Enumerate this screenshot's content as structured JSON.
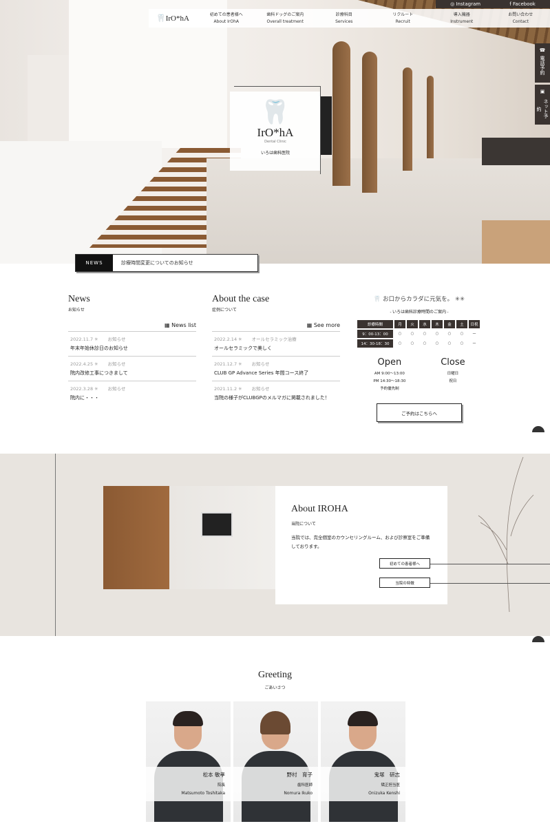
{
  "topbar": {
    "instagram": "Instagram",
    "facebook": "Facebook"
  },
  "nav": {
    "logo": "IrO*hA",
    "items": [
      {
        "jp": "初めての患者様へ",
        "en": "About IrOhA"
      },
      {
        "jp": "歯科ドッグのご案内",
        "en": "Overall treatment"
      },
      {
        "jp": "診療科目",
        "en": "Services"
      },
      {
        "jp": "リクルート",
        "en": "Recruit"
      },
      {
        "jp": "導入機器",
        "en": "Instrument"
      },
      {
        "jp": "お問い合わせ",
        "en": "Contact"
      }
    ]
  },
  "side": {
    "phone": "電話予約",
    "net": "ネット予約"
  },
  "hero": {
    "logo": "IrO*hA",
    "logo_sub": "Dental Clinic",
    "clinic": "いろは歯科医院"
  },
  "newsbar": {
    "label": "NEWS",
    "text": "診療時間変更についてのお知らせ"
  },
  "news": {
    "title": "News",
    "sub": "お知らせ",
    "more": "News list",
    "items": [
      {
        "date": "2022.11.7",
        "cat": "お知らせ",
        "title": "年末年始休診日のお知らせ"
      },
      {
        "date": "2022.4.25",
        "cat": "お知らせ",
        "title": "院内改修工事につきまして"
      },
      {
        "date": "2022.3.28",
        "cat": "お知らせ",
        "title": "院内に・・・"
      }
    ]
  },
  "cases": {
    "title": "About the case",
    "sub": "症例について",
    "more": "See more",
    "items": [
      {
        "date": "2022.2.14",
        "cat": "オールセラミック治療",
        "title": "オールセラミックで美しく"
      },
      {
        "date": "2021.12.7",
        "cat": "お知らせ",
        "title": "CLUB GP Advance Series 年間コース終了"
      },
      {
        "date": "2021.11.2",
        "cat": "お知らせ",
        "title": "当院の様子がCLUBGPのメルマガに掲載されました！"
      }
    ]
  },
  "hours": {
    "tagline": "お口からカラダに元気を。",
    "guide": "- いろは歯科診療時間のご案内 -",
    "header": [
      "診療時間",
      "月",
      "火",
      "水",
      "木",
      "金",
      "土",
      "日祝"
    ],
    "rows": [
      {
        "time": "9：00-13：00",
        "marks": [
          "○",
          "○",
          "○",
          "○",
          "○",
          "○",
          "ー"
        ]
      },
      {
        "time": "14：30-18：30",
        "marks": [
          "○",
          "○",
          "○",
          "○",
          "○",
          "○",
          "ー"
        ]
      }
    ],
    "open": {
      "title": "Open",
      "am": "AM  9:00〜13:00",
      "pm": "PM 14:30〜18:30",
      "note": "予約優先制"
    },
    "close": {
      "title": "Close",
      "l1": "日曜日",
      "l2": "祝日"
    },
    "reserve": "ご予約はこちらへ"
  },
  "about": {
    "title": "About IROHA",
    "sub": "当院について",
    "desc": "当院では、完全個室のカウンセリングルーム、および診察室をご準備しております。",
    "btn1": "初めての患者様へ",
    "btn2": "当院の特徴"
  },
  "greeting": {
    "title": "Greeting",
    "sub": "ごあいさつ",
    "staff": [
      {
        "jp": "松本 敏孝",
        "role": "院長",
        "en": "Matsumoto Toshitaka"
      },
      {
        "jp": "野村　育子",
        "role": "歯科医師",
        "en": "Nomura Ikuko"
      },
      {
        "jp": "鬼塚　研志",
        "role": "矯正担当医",
        "en": "Onizuka Kenshi"
      }
    ]
  }
}
